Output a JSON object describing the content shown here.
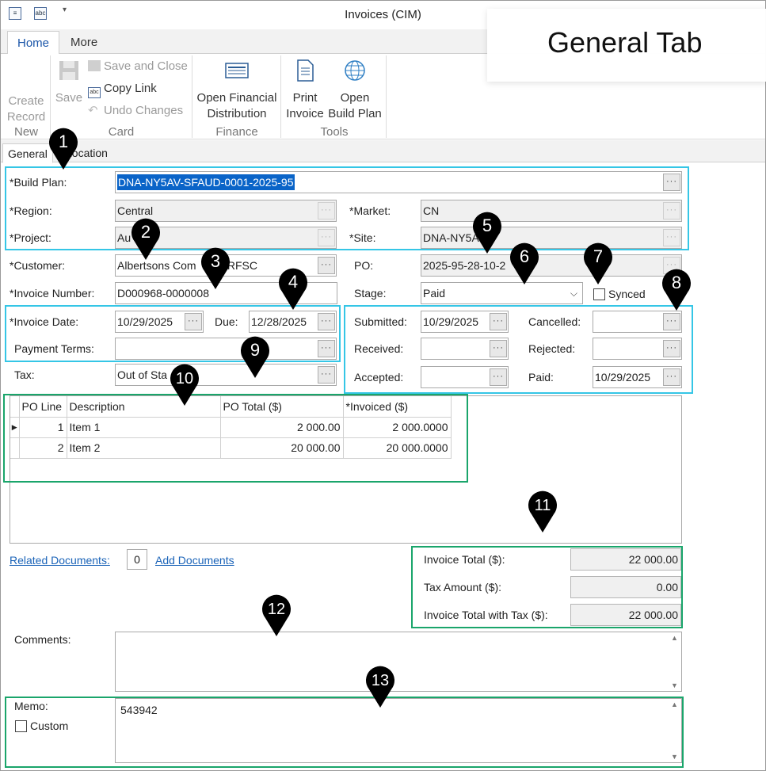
{
  "window": {
    "title": "Invoices (CIM)"
  },
  "overlay": {
    "title": "General Tab"
  },
  "ribbon_tabs": [
    "Home",
    "More"
  ],
  "ribbon": {
    "create_record": [
      "Create",
      "Record"
    ],
    "group_new": "New",
    "save": "Save",
    "save_and_close": "Save and Close",
    "copy_link": "Copy Link",
    "undo_changes": "Undo Changes",
    "group_card": "Card",
    "open_financial_distribution": [
      "Open Financial",
      "Distribution"
    ],
    "group_finance": "Finance",
    "print_invoice": [
      "Print",
      "Invoice"
    ],
    "open_build_plan": [
      "Open",
      "Build Plan"
    ],
    "group_tools": "Tools"
  },
  "subtabs": [
    "General",
    "Location"
  ],
  "form": {
    "build_plan_label": "*Build Plan:",
    "build_plan_value": "DNA-NY5AV-SFAUD-0001-2025-95",
    "region_label": "*Region:",
    "region_value": "Central",
    "market_label": "*Market:",
    "market_value": "CN",
    "project_label": "*Project:",
    "project_value": "Au",
    "site_label": "*Site:",
    "site_value": "DNA-NY5A",
    "customer_label": "*Customer:",
    "customer_value": "Albertsons Com",
    "customer_value_tail": "s RFSC",
    "po_label": "PO:",
    "po_value": "2025-95-28-10-2",
    "invoice_number_label": "*Invoice Number:",
    "invoice_number_value": "D000968-0000008",
    "stage_label": "Stage:",
    "stage_value": "Paid",
    "synced_label": "Synced",
    "invoice_date_label": "*Invoice Date:",
    "invoice_date_value": "10/29/2025",
    "due_label": "Due:",
    "due_value": "12/28/2025",
    "payment_terms_label": "Payment Terms:",
    "payment_terms_value": "",
    "tax_label": "Tax:",
    "tax_value": "Out of Sta",
    "submitted_label": "Submitted:",
    "submitted_value": "10/29/2025",
    "cancelled_label": "Cancelled:",
    "cancelled_value": "",
    "received_label": "Received:",
    "received_value": "",
    "rejected_label": "Rejected:",
    "rejected_value": "",
    "accepted_label": "Accepted:",
    "accepted_value": "",
    "paid_label": "Paid:",
    "paid_value": "10/29/2025"
  },
  "grid": {
    "columns": [
      "PO Line",
      "Description",
      "PO Total ($)",
      "*Invoiced ($)"
    ],
    "rows": [
      [
        "1",
        "Item 1",
        "2 000.00",
        "2 000.0000"
      ],
      [
        "2",
        "Item 2",
        "20 000.00",
        "20 000.0000"
      ]
    ]
  },
  "related": {
    "related_documents": "Related Documents:",
    "count": "0",
    "add_documents": "Add Documents"
  },
  "totals": {
    "invoice_total_label": "Invoice Total ($):",
    "invoice_total_value": "22 000.00",
    "tax_amount_label": "Tax Amount ($):",
    "tax_amount_value": "0.00",
    "invoice_total_tax_label": "Invoice Total with Tax ($):",
    "invoice_total_tax_value": "22 000.00"
  },
  "comments": {
    "label": "Comments:",
    "value": ""
  },
  "memo": {
    "label": "Memo:",
    "value": "543942",
    "custom_label": "Custom"
  },
  "callouts": [
    "1",
    "2",
    "3",
    "4",
    "5",
    "6",
    "7",
    "8",
    "9",
    "10",
    "11",
    "12",
    "13"
  ],
  "colors": {
    "callout_cyan": "#35c6e6",
    "callout_green": "#1aa56b",
    "selection": "#0a64c8",
    "link": "#1a63b8"
  }
}
